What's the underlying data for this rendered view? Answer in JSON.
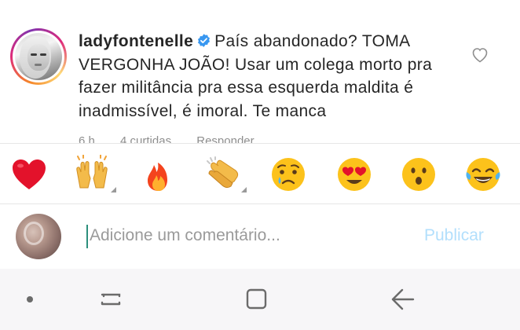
{
  "comment": {
    "username": "ladyfontenelle",
    "text": "País abandonado? TOMA VERGONHA JOÃO! Usar um colega morto pra fazer militância pra essa esquerda maldita  é inadmissível, é imoral. Te manca",
    "meta": {
      "time": "6 h",
      "likes": "4 curtidas",
      "reply": "Responder"
    }
  },
  "emoji_bar": {
    "items": [
      {
        "name": "red-heart",
        "glyph": "❤️"
      },
      {
        "name": "raising-hands",
        "glyph": "🙌"
      },
      {
        "name": "fire",
        "glyph": "🔥"
      },
      {
        "name": "clapping-hands",
        "glyph": "👏"
      },
      {
        "name": "crying-face",
        "glyph": "😢"
      },
      {
        "name": "heart-eyes",
        "glyph": "😍"
      },
      {
        "name": "surprised-face",
        "glyph": "😮"
      },
      {
        "name": "tears-of-joy",
        "glyph": "😂"
      }
    ]
  },
  "compose": {
    "placeholder": "Adicione um comentário...",
    "value": "",
    "publish_label": "Publicar"
  },
  "colors": {
    "verified_blue": "#3897f0",
    "publish_disabled": "#b2dffc",
    "caret": "#2c8f7c",
    "meta_gray": "#8e8e8e",
    "nav_bg": "#f7f6f8"
  },
  "icons": [
    "verified-badge-icon",
    "heart-outline-icon",
    "recent-apps-icon",
    "home-icon",
    "back-icon",
    "dot-icon"
  ]
}
